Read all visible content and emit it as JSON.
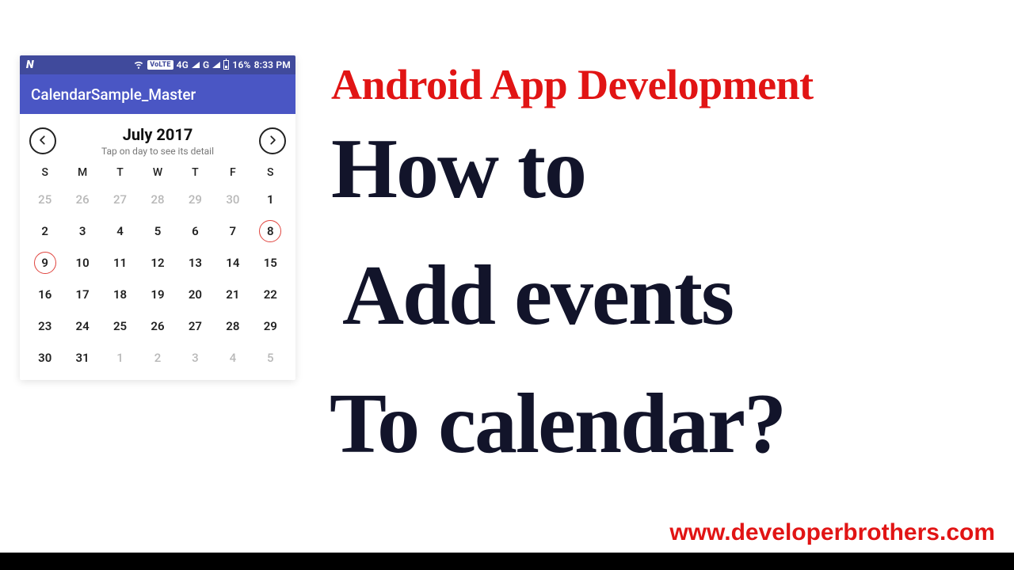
{
  "headline": {
    "category": "Android App Development",
    "line1": "How to",
    "line2": "Add events",
    "line3": "To calendar?",
    "footer_url": "www.developerbrothers.com"
  },
  "phone": {
    "statusbar": {
      "volte_badge": "VoLTE",
      "net_label": "4G",
      "g_label": "G",
      "battery_pct": "16%",
      "time": "8:33 PM"
    },
    "appbar_title": "CalendarSample_Master",
    "calendar": {
      "month_label": "July 2017",
      "subtitle": "Tap on day to see its detail",
      "dow": [
        "S",
        "M",
        "T",
        "W",
        "T",
        "F",
        "S"
      ],
      "weeks": [
        [
          {
            "d": "25",
            "other": true
          },
          {
            "d": "26",
            "other": true
          },
          {
            "d": "27",
            "other": true
          },
          {
            "d": "28",
            "other": true
          },
          {
            "d": "29",
            "other": true
          },
          {
            "d": "30",
            "other": true
          },
          {
            "d": "1"
          }
        ],
        [
          {
            "d": "2"
          },
          {
            "d": "3"
          },
          {
            "d": "4"
          },
          {
            "d": "5"
          },
          {
            "d": "6"
          },
          {
            "d": "7"
          },
          {
            "d": "8",
            "marked": true
          }
        ],
        [
          {
            "d": "9",
            "marked": true
          },
          {
            "d": "10"
          },
          {
            "d": "11"
          },
          {
            "d": "12"
          },
          {
            "d": "13"
          },
          {
            "d": "14"
          },
          {
            "d": "15"
          }
        ],
        [
          {
            "d": "16"
          },
          {
            "d": "17"
          },
          {
            "d": "18"
          },
          {
            "d": "19"
          },
          {
            "d": "20"
          },
          {
            "d": "21"
          },
          {
            "d": "22"
          }
        ],
        [
          {
            "d": "23"
          },
          {
            "d": "24"
          },
          {
            "d": "25"
          },
          {
            "d": "26"
          },
          {
            "d": "27"
          },
          {
            "d": "28"
          },
          {
            "d": "29"
          }
        ],
        [
          {
            "d": "30"
          },
          {
            "d": "31"
          },
          {
            "d": "1",
            "other": true
          },
          {
            "d": "2",
            "other": true
          },
          {
            "d": "3",
            "other": true
          },
          {
            "d": "4",
            "other": true
          },
          {
            "d": "5",
            "other": true
          }
        ]
      ]
    }
  }
}
